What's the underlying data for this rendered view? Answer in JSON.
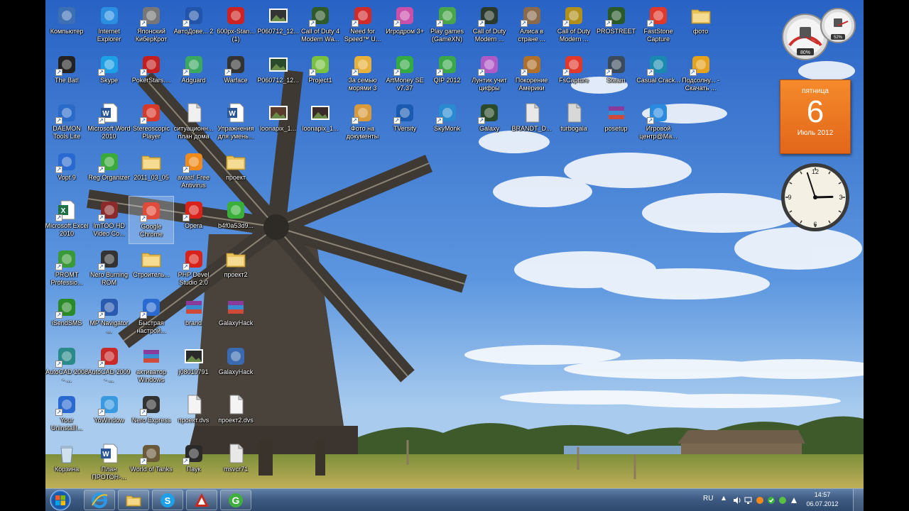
{
  "desktop": {
    "icons": [
      {
        "label": "Компьютер",
        "icon": "computer-icon",
        "color": "#3d6fb5",
        "shortcut": false
      },
      {
        "label": "Internet Explorer",
        "icon": "ie-icon",
        "color": "#2a8fe0",
        "shortcut": false
      },
      {
        "label": "Японский КиберКрот",
        "icon": "game-icon",
        "color": "#777777",
        "shortcut": true
      },
      {
        "label": "АвтоДове... 2",
        "icon": "app-icon",
        "color": "#2255aa",
        "shortcut": true
      },
      {
        "label": "600px-Stan... (1)",
        "icon": "flag-icon",
        "color": "#cc2222",
        "shortcut": false
      },
      {
        "label": "P060712_12...",
        "icon": "photo-icon",
        "color": "#333333",
        "shortcut": false
      },
      {
        "label": "Call of Duty 4 Modern Wa...",
        "icon": "cod-icon",
        "color": "#2f5a2a",
        "shortcut": true
      },
      {
        "label": "Need for Speed™ U...",
        "icon": "nfs-icon",
        "color": "#d12a2a",
        "shortcut": true
      },
      {
        "label": "Игродром 3+",
        "icon": "game-icon",
        "color": "#c94fa8",
        "shortcut": true
      },
      {
        "label": "Play games (GameXN)",
        "icon": "gamexn-icon",
        "color": "#4aa64a",
        "shortcut": true
      },
      {
        "label": "Call of Duty Modern ...",
        "icon": "cod-icon",
        "color": "#2a3a2a",
        "shortcut": true
      },
      {
        "label": "Алиса в стране ...",
        "icon": "game-icon",
        "color": "#8a6a4a",
        "shortcut": true
      },
      {
        "label": "Call of Duty Modern ...",
        "icon": "cod-icon",
        "color": "#b0901a",
        "shortcut": true
      },
      {
        "label": "PROSTREET",
        "icon": "nfs-icon",
        "color": "#2a5a2a",
        "shortcut": true
      },
      {
        "label": "FastStone Capture",
        "icon": "faststone-icon",
        "color": "#e0382a",
        "shortcut": true
      },
      {
        "label": "фото",
        "icon": "folder-icon",
        "color": "#e9c25a",
        "shortcut": false
      },
      {
        "label": "The Bat!",
        "icon": "bat-icon",
        "color": "#222222",
        "shortcut": true
      },
      {
        "label": "Skype",
        "icon": "skype-icon",
        "color": "#1ea0e6",
        "shortcut": true
      },
      {
        "label": "PokerStars....",
        "icon": "poker-icon",
        "color": "#c41e1e",
        "shortcut": true
      },
      {
        "label": "Adguard",
        "icon": "shield-icon",
        "color": "#3aa860",
        "shortcut": true
      },
      {
        "label": "Warface",
        "icon": "warface-icon",
        "color": "#333333",
        "shortcut": true
      },
      {
        "label": "P060712_12...",
        "icon": "photo-icon",
        "color": "#2a4a2a",
        "shortcut": false
      },
      {
        "label": "Project1",
        "icon": "project-icon",
        "color": "#7ac142",
        "shortcut": true
      },
      {
        "label": "За семью морями 3",
        "icon": "game-icon",
        "color": "#e6b03a",
        "shortcut": true
      },
      {
        "label": "ArtMoney SE v7.37",
        "icon": "money-icon",
        "color": "#33aa44",
        "shortcut": true
      },
      {
        "label": "QIP 2012",
        "icon": "qip-icon",
        "color": "#3aa84a",
        "shortcut": true
      },
      {
        "label": "Лунтик учит цифры",
        "icon": "game-icon",
        "color": "#b05ac8",
        "shortcut": true
      },
      {
        "label": "Покорение Америки",
        "icon": "game-icon",
        "color": "#b0702a",
        "shortcut": true
      },
      {
        "label": "FsCapture",
        "icon": "faststone-icon",
        "color": "#e0382a",
        "shortcut": true
      },
      {
        "label": "Steam",
        "icon": "steam-icon",
        "color": "#3a4a5a",
        "shortcut": true
      },
      {
        "label": "Casual Crack...",
        "icon": "app-icon",
        "color": "#1a8ab0",
        "shortcut": true
      },
      {
        "label": "Подсолну... - Скачать ...",
        "icon": "sunflower-icon",
        "color": "#e6a21a",
        "shortcut": true
      },
      {
        "label": "DAEMON Tools Lite",
        "icon": "daemon-icon",
        "color": "#2a6ac8",
        "shortcut": true
      },
      {
        "label": "Microsoft Word 2010",
        "icon": "word-icon",
        "color": "#2b5797",
        "shortcut": true
      },
      {
        "label": "Stereoscopic Player",
        "icon": "player-icon",
        "color": "#d83a2a",
        "shortcut": true
      },
      {
        "label": "ситуационн... план дома",
        "icon": "document-icon",
        "color": "#f0f0f0",
        "shortcut": false
      },
      {
        "label": "Упражнения для умень...",
        "icon": "word-doc-icon",
        "color": "#2b5797",
        "shortcut": false
      },
      {
        "label": "loonapix_1...",
        "icon": "photo-icon",
        "color": "#5a3a2a",
        "shortcut": false
      },
      {
        "label": "loonapix_1...",
        "icon": "photo-icon",
        "color": "#3a2a2a",
        "shortcut": false
      },
      {
        "label": "Фото на документы",
        "icon": "photo-doc-icon",
        "color": "#d89a3a",
        "shortcut": true
      },
      {
        "label": "TVersity",
        "icon": "tversity-icon",
        "color": "#1a5ab0",
        "shortcut": true
      },
      {
        "label": "SkyMonk",
        "icon": "skymonk-icon",
        "color": "#2a8ad0",
        "shortcut": true
      },
      {
        "label": "Galaxy",
        "icon": "galaxy-icon",
        "color": "#2a4a2a",
        "shortcut": true
      },
      {
        "label": "BRANDT_D...",
        "icon": "document-icon",
        "color": "#e8e8e8",
        "shortcut": false
      },
      {
        "label": "turbogala",
        "icon": "document-icon",
        "color": "#d8d8d8",
        "shortcut": false
      },
      {
        "label": "posetup",
        "icon": "archive-icon",
        "color": "#7a2a8a",
        "shortcut": false
      },
      {
        "label": "Игровой центр@Ма...",
        "icon": "game-center-icon",
        "color": "#2a8ae0",
        "shortcut": true
      },
      {
        "label": "Vopt 9",
        "icon": "vopt-icon",
        "color": "#2a6ad0",
        "shortcut": true
      },
      {
        "label": "Reg Organizer",
        "icon": "reg-icon",
        "color": "#3aaa3a",
        "shortcut": true
      },
      {
        "label": "2011_03_05",
        "icon": "folder-icon",
        "color": "#e9c25a",
        "shortcut": false
      },
      {
        "label": "avast! Free Antivirus",
        "icon": "avast-icon",
        "color": "#f08a1a",
        "shortcut": true
      },
      {
        "label": "проект",
        "icon": "folder-icon",
        "color": "#e9c25a",
        "shortcut": false
      },
      {
        "label": "Microsoft Excel 2010",
        "icon": "excel-icon",
        "color": "#1e7145",
        "shortcut": true
      },
      {
        "label": "ImTOO HD Video Co...",
        "icon": "video-icon",
        "color": "#8a2a2a",
        "shortcut": true
      },
      {
        "label": "Google Chrome",
        "icon": "chrome-icon",
        "color": "#e04a3a",
        "shortcut": true
      },
      {
        "label": "Opera",
        "icon": "opera-icon",
        "color": "#d8221a",
        "shortcut": true
      },
      {
        "label": "b4f0a53d9...",
        "icon": "alien-icon",
        "color": "#3ab03a",
        "shortcut": false
      },
      {
        "label": "PROMT Professio...",
        "icon": "promt-icon",
        "color": "#3a9a3a",
        "shortcut": true
      },
      {
        "label": "Nero Burning ROM",
        "icon": "nero-icon",
        "color": "#333333",
        "shortcut": true
      },
      {
        "label": "Строитель...",
        "icon": "folder-icon",
        "color": "#e9c25a",
        "shortcut": false
      },
      {
        "label": "PHP Devel Studio 2.0",
        "icon": "php-icon",
        "color": "#d8221a",
        "shortcut": true
      },
      {
        "label": "проект2",
        "icon": "folder-icon",
        "color": "#e9c25a",
        "shortcut": false
      },
      {
        "label": "iSendSMS",
        "icon": "sms-icon",
        "color": "#2a8a2a",
        "shortcut": true
      },
      {
        "label": "MP Navigator ...",
        "icon": "scanner-icon",
        "color": "#2a5ab0",
        "shortcut": true
      },
      {
        "label": "Быстрая настрой...",
        "icon": "settings-icon",
        "color": "#2a6ad0",
        "shortcut": true
      },
      {
        "label": "brand",
        "icon": "archive-icon",
        "color": "#7a2a8a",
        "shortcut": false
      },
      {
        "label": "GalaxyHack",
        "icon": "archive-icon",
        "color": "#7a2a8a",
        "shortcut": false
      },
      {
        "label": "AutoCAD 2008 - ...",
        "icon": "autocad-icon",
        "color": "#2a8a8a",
        "shortcut": true
      },
      {
        "label": "AutoCAD 2009 - ...",
        "icon": "autocad-icon",
        "color": "#c82a2a",
        "shortcut": true
      },
      {
        "label": "активатор Windows",
        "icon": "archive-icon",
        "color": "#7a2a8a",
        "shortcut": false
      },
      {
        "label": "j08019791",
        "icon": "photo-icon",
        "color": "#2a2a2a",
        "shortcut": false
      },
      {
        "label": "GalaxyHack",
        "icon": "window-icon",
        "color": "#3a6ab0",
        "shortcut": false
      },
      {
        "label": "Your Uninstall!...",
        "icon": "uninstall-icon",
        "color": "#2a6ad0",
        "shortcut": true
      },
      {
        "label": "YoWindow",
        "icon": "weather-icon",
        "color": "#3a9ae0",
        "shortcut": true
      },
      {
        "label": "Nero Express",
        "icon": "nero-icon",
        "color": "#333333",
        "shortcut": true
      },
      {
        "label": "проект.dvs",
        "icon": "document-icon",
        "color": "#f4f4f4",
        "shortcut": false
      },
      {
        "label": "проект2.dvs",
        "icon": "document-icon",
        "color": "#f4f4f4",
        "shortcut": false
      },
      {
        "label": "Корзина",
        "icon": "recycle-bin-icon",
        "color": "#a0b8d0",
        "shortcut": false
      },
      {
        "label": "План ПРОТОН-...",
        "icon": "word-doc-icon",
        "color": "#2b5797",
        "shortcut": false
      },
      {
        "label": "World of Tanks",
        "icon": "tanks-icon",
        "color": "#6a5a3a",
        "shortcut": true
      },
      {
        "label": "Паук",
        "icon": "spider-icon",
        "color": "#2a2a2a",
        "shortcut": true
      },
      {
        "label": "msvcr71",
        "icon": "dll-icon",
        "color": "#e8e8e8",
        "shortcut": false
      }
    ],
    "selected_index": 54
  },
  "gadgets": {
    "meter": {
      "cpu": "80%",
      "memory": "52%",
      "cpu_value": 80,
      "memory_value": 52
    },
    "calendar": {
      "weekday": "пятница",
      "day": "6",
      "month_year": "Июль 2012",
      "color": "#f0781f"
    },
    "clock": {
      "hour": 2,
      "minute": 57
    }
  },
  "taskbar": {
    "start_label": "Пуск",
    "pinned": [
      {
        "name": "ie",
        "icon": "ie-icon"
      },
      {
        "name": "explorer",
        "icon": "folder-icon"
      },
      {
        "name": "skype",
        "icon": "skype-icon"
      },
      {
        "name": "autocad",
        "icon": "autocad-icon"
      },
      {
        "name": "gamexn",
        "icon": "gamexn-icon"
      }
    ],
    "tray": {
      "lang": "RU",
      "up_arrow": "▲",
      "time": "14:57",
      "date": "06.07.2012"
    }
  },
  "colors": {
    "sky_top": "#2e6fcf",
    "sky_bottom": "#9cc3ee",
    "accent": "#f0781f"
  }
}
